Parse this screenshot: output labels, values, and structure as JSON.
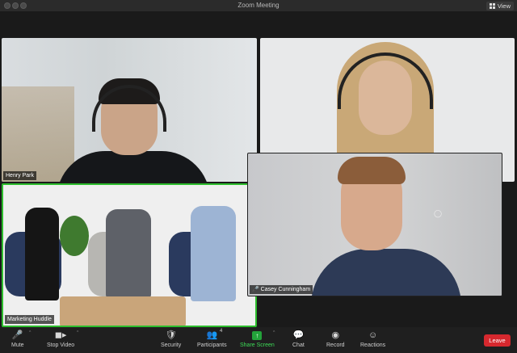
{
  "window": {
    "title": "Zoom Meeting",
    "view_label": "View"
  },
  "participants": [
    {
      "name": "Henry Park"
    },
    {
      "name": "Casey Cunningham"
    },
    {
      "name": "Marketing Huddle"
    }
  ],
  "toolbar": {
    "mute": "Mute",
    "stop_video": "Stop Video",
    "security": "Security",
    "participants": "Participants",
    "participants_count": "4",
    "share_screen": "Share Screen",
    "chat": "Chat",
    "record": "Record",
    "reactions": "Reactions",
    "leave": "Leave"
  },
  "colors": {
    "active_speaker": "#2dbd2d",
    "share_screen": "#23a23a",
    "leave": "#d6282e"
  },
  "icons": [
    "mic-icon",
    "camera-icon",
    "shield-icon",
    "people-icon",
    "share-arrow-icon",
    "chat-icon",
    "record-icon",
    "reaction-icon",
    "grid-icon"
  ]
}
